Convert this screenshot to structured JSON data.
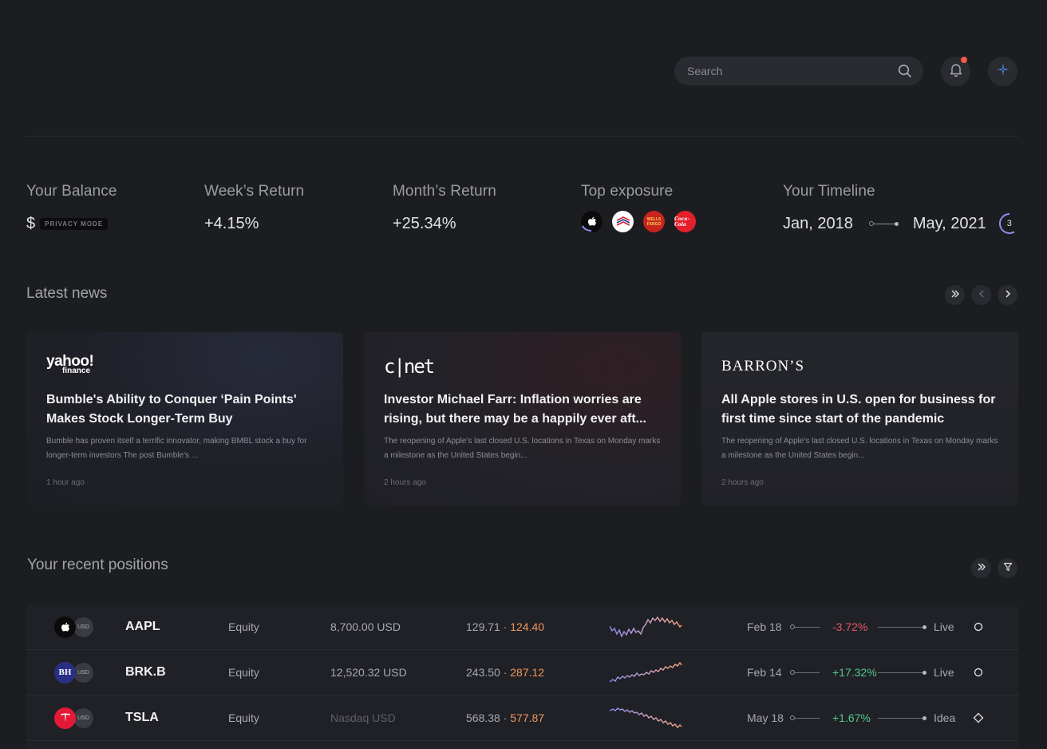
{
  "header": {
    "search_placeholder": "Search"
  },
  "stats": {
    "balance": {
      "label": "Your Balance",
      "currency": "$",
      "privacy": "PRIVACY MODE"
    },
    "week": {
      "label": "Week’s Return",
      "value": "+4.15%"
    },
    "month": {
      "label": "Month’s Return",
      "value": "+25.34%"
    },
    "exposure": {
      "label": "Top exposure",
      "logos": [
        "apple-logo",
        "bank-of-america-logo",
        "wells-fargo-logo",
        "coca-cola-logo"
      ],
      "wells": "WELLS FARGO",
      "coke": "Coca-Cola"
    },
    "timeline": {
      "label": "Your Timeline",
      "start": "Jan, 2018",
      "end": "May, 2021",
      "count": "3"
    }
  },
  "news": {
    "title": "Latest news",
    "cards": [
      {
        "source": "yahoo!",
        "source_sub": "finance",
        "headline": "Bumble's Ability to Conquer ‘Pain Points' Makes Stock Longer-Term Buy",
        "body": "Bumble has proven itself a terrific innovator, making BMBL stock a buy for longer-term investors The post Bumble's ...",
        "time": "1 hour ago"
      },
      {
        "source": "c|net",
        "headline": "Investor Michael Farr: Inflation worries are rising, but there may be a happily ever aft...",
        "body": "The reopening of Apple's last closed U.S. locations in Texas on Monday marks a milestone as the United States begin...",
        "time": "2 hours ago"
      },
      {
        "source": "BARRON’S",
        "headline": "All Apple stores in U.S. open for business for first time since start of the pandemic",
        "body": "The reopening of Apple's last closed U.S. locations in Texas on Monday marks a milestone as the United States begin...",
        "time": "2 hours ago"
      }
    ]
  },
  "positions": {
    "title": "Your recent positions",
    "rows": [
      {
        "ticker_icon": "apple-logo",
        "cur": "USD",
        "symbol": "AAPL",
        "type": "Equity",
        "amount": "8,700.00 USD",
        "price_from": "129.71 · ",
        "price_to": "124.40",
        "date": "Feb 18",
        "change": "-3.72%",
        "status": "Live"
      },
      {
        "ticker_icon": "berkshire-logo",
        "ticker_text": "BH",
        "cur": "USD",
        "symbol": "BRK.B",
        "type": "Equity",
        "amount": "12,520.32 USD",
        "price_from": "243.50 · ",
        "price_to": "287.12",
        "date": "Feb 14",
        "change": "+17.32%",
        "status": "Live"
      },
      {
        "ticker_icon": "tesla-logo",
        "cur": "USD",
        "symbol": "TSLA",
        "type": "Equity",
        "amount": "Nasdaq USD",
        "price_from": "568.38 · ",
        "price_to": "577.87",
        "date": "May 18",
        "change": "+1.67%",
        "status": "Idea"
      }
    ]
  },
  "colors": {
    "background": "#1c1d21",
    "positive": "#4fc98d",
    "negative": "#e4576a",
    "price_highlight": "#f0955f",
    "notification": "#f15a4a",
    "accent": "#3b82f6"
  }
}
